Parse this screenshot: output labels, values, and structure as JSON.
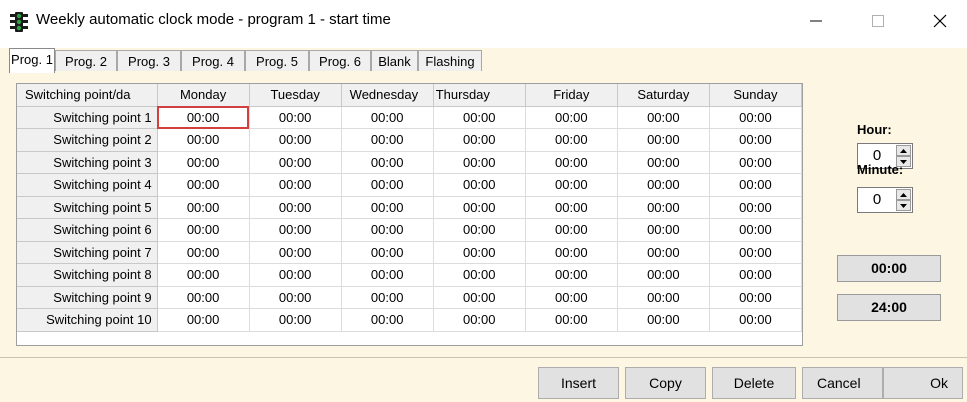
{
  "window": {
    "title": "Weekly automatic clock mode - program  1 - start time",
    "icon": "traffic-light-icon"
  },
  "tabs": [
    "Prog. 1",
    "Prog. 2",
    "Prog. 3",
    "Prog. 4",
    "Prog. 5",
    "Prog. 6",
    "Blank",
    "Flashing"
  ],
  "active_tab": "Prog. 1",
  "grid": {
    "corner_header": "Switching point/da",
    "days": [
      "Monday",
      "Tuesday",
      "Wednesday",
      "Thursday",
      "Friday",
      "Saturday",
      "Sunday"
    ],
    "rows": [
      {
        "label": "Switching point  1",
        "values": [
          "00:00",
          "00:00",
          "00:00",
          "00:00",
          "00:00",
          "00:00",
          "00:00"
        ]
      },
      {
        "label": "Switching point  2",
        "values": [
          "00:00",
          "00:00",
          "00:00",
          "00:00",
          "00:00",
          "00:00",
          "00:00"
        ]
      },
      {
        "label": "Switching point  3",
        "values": [
          "00:00",
          "00:00",
          "00:00",
          "00:00",
          "00:00",
          "00:00",
          "00:00"
        ]
      },
      {
        "label": "Switching point  4",
        "values": [
          "00:00",
          "00:00",
          "00:00",
          "00:00",
          "00:00",
          "00:00",
          "00:00"
        ]
      },
      {
        "label": "Switching point  5",
        "values": [
          "00:00",
          "00:00",
          "00:00",
          "00:00",
          "00:00",
          "00:00",
          "00:00"
        ]
      },
      {
        "label": "Switching point  6",
        "values": [
          "00:00",
          "00:00",
          "00:00",
          "00:00",
          "00:00",
          "00:00",
          "00:00"
        ]
      },
      {
        "label": "Switching point  7",
        "values": [
          "00:00",
          "00:00",
          "00:00",
          "00:00",
          "00:00",
          "00:00",
          "00:00"
        ]
      },
      {
        "label": "Switching point  8",
        "values": [
          "00:00",
          "00:00",
          "00:00",
          "00:00",
          "00:00",
          "00:00",
          "00:00"
        ]
      },
      {
        "label": "Switching point  9",
        "values": [
          "00:00",
          "00:00",
          "00:00",
          "00:00",
          "00:00",
          "00:00",
          "00:00"
        ]
      },
      {
        "label": "Switching point 10",
        "values": [
          "00:00",
          "00:00",
          "00:00",
          "00:00",
          "00:00",
          "00:00",
          "00:00"
        ]
      }
    ],
    "selection_color": "#d23f3f"
  },
  "panel": {
    "hour_label": "Hour:",
    "hour_value": "0",
    "minute_label": "Minute:",
    "minute_value": "0",
    "time_button_1": "00:00",
    "time_button_2": "24:00"
  },
  "buttons": {
    "insert": "Insert",
    "copy": "Copy",
    "delete": "Delete",
    "cancel": "Cancel",
    "ok": "Ok"
  },
  "colors": {
    "panel_background": "#fdf6e3"
  }
}
